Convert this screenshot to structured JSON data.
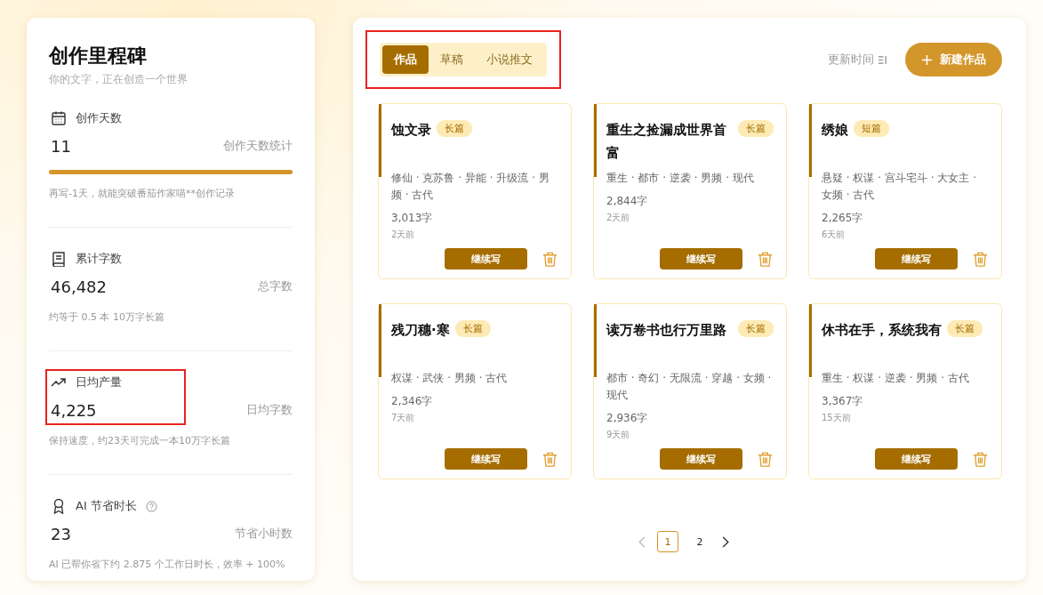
{
  "milestones": {
    "title": "创作里程碑",
    "subtitle": "你的文字，正在创造一个世界",
    "stats": [
      {
        "kind": "calendar",
        "label": "创作天数",
        "value": "11",
        "unit": "创作天数统计",
        "level": 1,
        "note": "再写-1天，就能突破番茄作家喵**创作记录",
        "highlighted": false,
        "help": false
      },
      {
        "kind": "book",
        "label": "累计字数",
        "value": "46,482",
        "unit": "总字数",
        "note": "约等于 0.5 本 10万字长篇",
        "highlighted": false,
        "help": false
      },
      {
        "kind": "trend",
        "label": "日均产量",
        "value": "4,225",
        "unit": "日均字数",
        "note": "保持速度，约23天可完成一本10万字长篇",
        "highlighted": true,
        "help": false
      },
      {
        "kind": "award",
        "label": "AI 节省时长",
        "value": "23",
        "unit": "节省小时数",
        "note": "AI 已帮你省下约 2.875 个工作日时长，效率 + 100%",
        "highlighted": false,
        "help": true
      }
    ]
  },
  "works": {
    "tabs_highlighted": true,
    "tabs": [
      {
        "label": "作品",
        "selected": true
      },
      {
        "label": "草稿",
        "selected": false
      },
      {
        "label": "小说推文",
        "selected": false
      }
    ],
    "sort": "更新时间",
    "new_button": "新建作品",
    "cards": [
      {
        "title": "蚀文录",
        "tag": "长篇",
        "genres": "修仙 · 克苏鲁 · 异能 · 升级流 · 男频 · 古代",
        "words": "3,013字",
        "updated": "2天前",
        "button": "继续写"
      },
      {
        "title": "重生之捡漏成世界首富",
        "tag": "长篇",
        "genres": "重生 · 都市 · 逆袭 · 男频 · 现代",
        "words": "2,844字",
        "updated": "2天前",
        "button": "继续写"
      },
      {
        "title": "绣娘",
        "tag": "短篇",
        "genres": "悬疑 · 权谋 · 宫斗宅斗 · 大女主 · 女频 · 古代",
        "words": "2,265字",
        "updated": "6天前",
        "button": "继续写"
      },
      {
        "title": "残刀穗·寒",
        "tag": "长篇",
        "genres": "权谋 · 武侠 · 男频 · 古代",
        "words": "2,346字",
        "updated": "7天前",
        "button": "继续写"
      },
      {
        "title": "读万卷书也行万里路",
        "tag": "长篇",
        "genres": "都市 · 奇幻 · 无限流 · 穿越 · 女频 · 现代",
        "words": "2,936字",
        "updated": "9天前",
        "button": "继续写"
      },
      {
        "title": "休书在手，系统我有",
        "tag": "长篇",
        "genres": "重生 · 权谋 · 逆袭 · 男频 · 古代",
        "words": "3,367字",
        "updated": "15天前",
        "button": "继续写"
      }
    ],
    "pages": [
      {
        "label": "1",
        "selected": true
      },
      {
        "label": "2",
        "selected": false
      }
    ]
  }
}
